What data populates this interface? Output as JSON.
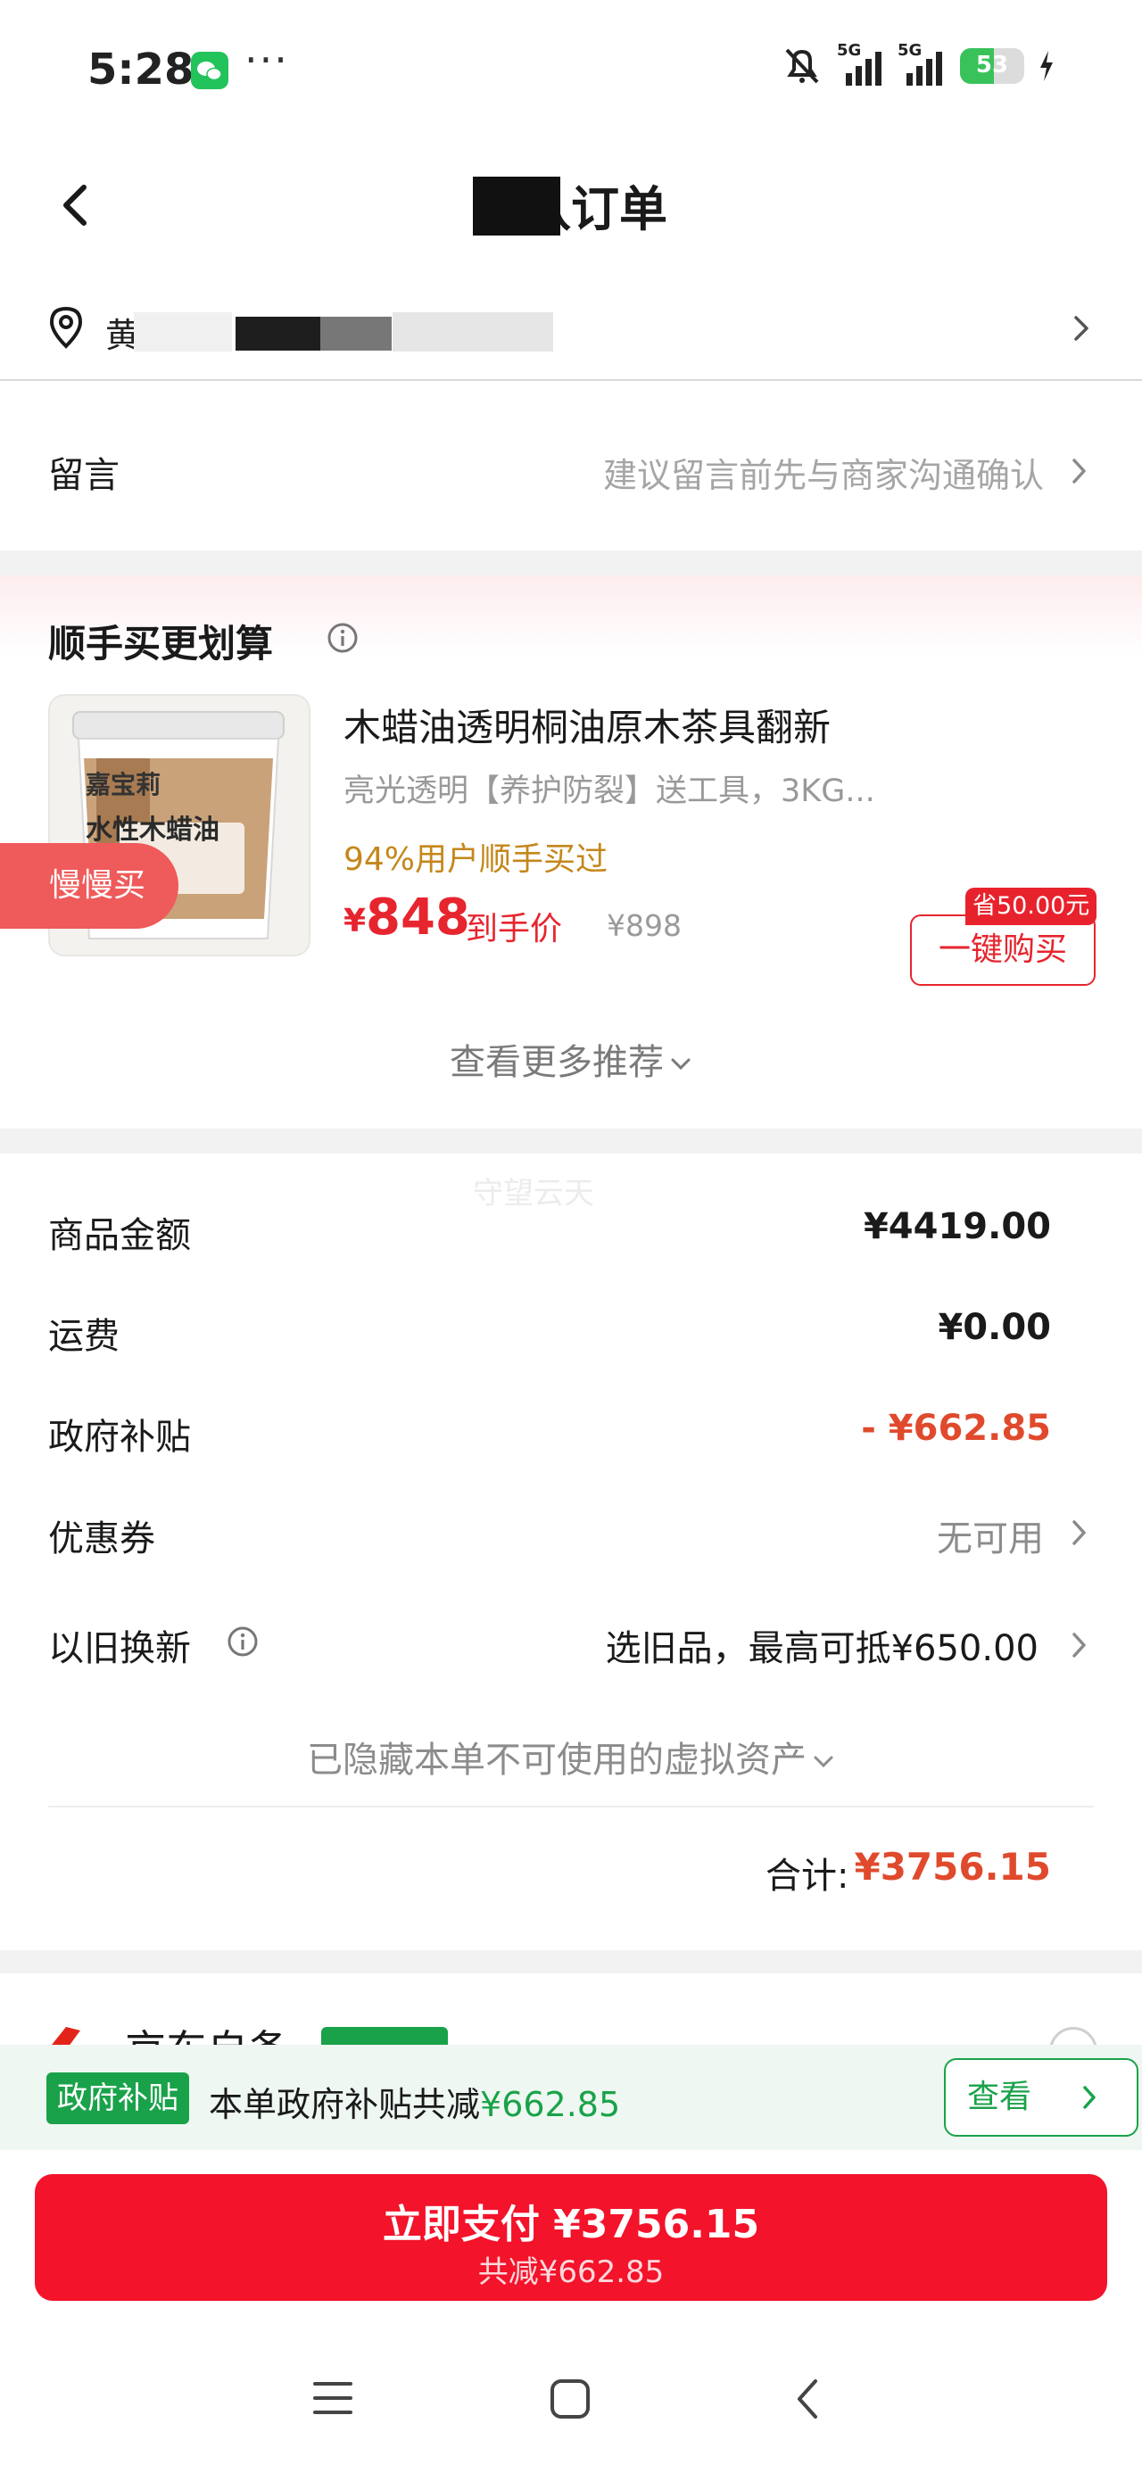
{
  "status_bar": {
    "time": "5:28",
    "more": "···",
    "signal_1": "5G",
    "signal_2": "5G",
    "battery": "53"
  },
  "header": {
    "title": "确认订单"
  },
  "address": {
    "text": "黄"
  },
  "message": {
    "label": "留言",
    "placeholder": "建议留言前先与商家沟通确认"
  },
  "buy_along": {
    "title": "顺手买更划算",
    "product": {
      "name": "木蜡油透明桐油原木茶具翻新",
      "spec": "亮光透明【养护防裂】送工具，3KG...",
      "social_proof": "94%用户顺手买过",
      "currency": "¥",
      "price": "848",
      "price_tag": "到手价",
      "original_price": "¥898",
      "save_badge": "省50.00元",
      "buy_button": "一键购买",
      "brand_label": "嘉宝莉",
      "product_label": "水性木蜡油"
    },
    "float_button": "慢慢买",
    "see_more": "查看更多推荐"
  },
  "summary": {
    "watermark": "守望云天",
    "rows": [
      {
        "label": "商品金额",
        "value": "¥4419.00"
      },
      {
        "label": "运费",
        "value": "¥0.00"
      },
      {
        "label": "政府补贴",
        "value": "- ¥662.85"
      },
      {
        "label": "优惠券",
        "value": "无可用"
      },
      {
        "label": "以旧换新",
        "value": "选旧品，最高可抵¥650.00"
      }
    ],
    "hidden_assets": "已隐藏本单不可使用的虚拟资产",
    "total_label": "合计:",
    "total_value": "¥3756.15"
  },
  "delivery": {
    "text": "京东自备"
  },
  "subsidy_bar": {
    "badge": "政府补贴",
    "text": "本单政府补贴共减",
    "amount": "¥662.85",
    "view_button": "查看"
  },
  "pay": {
    "main": "立即支付 ¥3756.15",
    "sub": "共减¥662.85"
  },
  "colors": {
    "accent_red": "#e6252e",
    "pay_red": "#f3132a",
    "subsidy_green": "#1aa24a",
    "social_orange": "#c4871b"
  }
}
